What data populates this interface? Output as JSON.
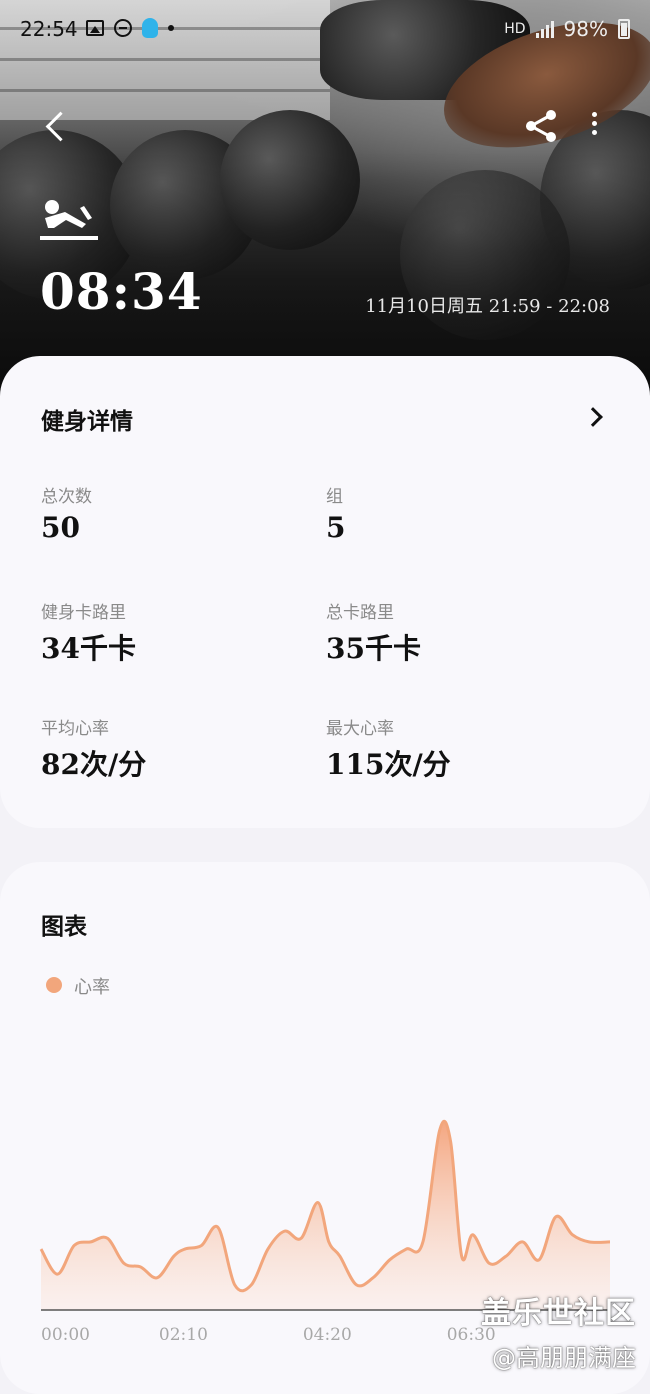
{
  "status_bar": {
    "time": "22:54",
    "battery": "98%",
    "left_icons": [
      "gallery-icon",
      "dnd-icon",
      "qq-icon",
      "dot-icon"
    ],
    "right_icons": [
      "bluetooth-icon",
      "mute-icon",
      "wifi-icon",
      "hd-icon",
      "4g-signal-icon",
      "battery-icon"
    ]
  },
  "header": {
    "workout_type_icon": "strength-training-icon",
    "duration": "08:34",
    "date_range": "11月10日周五 21:59 - 22:08"
  },
  "details": {
    "title": "健身详情",
    "stats": [
      {
        "label": "总次数",
        "value": "50"
      },
      {
        "label": "组",
        "value": "5"
      },
      {
        "label": "健身卡路里",
        "value": "34千卡"
      },
      {
        "label": "总卡路里",
        "value": "35千卡"
      },
      {
        "label": "平均心率",
        "value": "82次/分"
      },
      {
        "label": "最大心率",
        "value": "115次/分"
      }
    ]
  },
  "chart_section": {
    "title": "图表",
    "legend": "心率",
    "accent_color": "#f2a67c"
  },
  "chart_data": {
    "type": "area",
    "series": [
      {
        "name": "心率",
        "x": [
          "00:00",
          "00:15",
          "00:30",
          "00:45",
          "01:00",
          "01:15",
          "01:30",
          "01:45",
          "02:00",
          "02:10",
          "02:25",
          "02:40",
          "02:55",
          "03:10",
          "03:25",
          "03:40",
          "03:55",
          "04:10",
          "04:20",
          "04:30",
          "04:45",
          "05:00",
          "05:15",
          "05:30",
          "05:45",
          "06:00",
          "06:10",
          "06:20",
          "06:30",
          "06:45",
          "07:00",
          "07:15",
          "07:30",
          "07:45",
          "08:00",
          "08:15",
          "08:34"
        ],
        "values": [
          82,
          75,
          83,
          84,
          85,
          78,
          77,
          74,
          80,
          82,
          83,
          88,
          72,
          72,
          82,
          87,
          85,
          95,
          84,
          80,
          72,
          74,
          79,
          82,
          84,
          115,
          112,
          80,
          86,
          78,
          80,
          84,
          79,
          91,
          86,
          84,
          84
        ]
      }
    ],
    "x_ticks": [
      "00:00",
      "02:10",
      "04:20",
      "06:30"
    ],
    "ylim": [
      65,
      118
    ],
    "grid": false,
    "legend_position": "top-left"
  },
  "watermark": {
    "line1": "盖乐世社区",
    "line2": "@高朋朋满座"
  }
}
